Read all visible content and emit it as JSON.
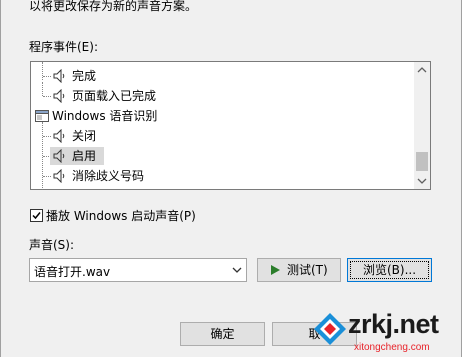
{
  "intro_text": "以将更改保存为新的声音方案。",
  "events_label": "程序事件(E):",
  "tree_items": [
    {
      "label": "完成",
      "icon": "speaker-icon"
    },
    {
      "label": "页面载入已完成",
      "icon": "speaker-icon"
    },
    {
      "label": "Windows 语音识别",
      "icon": "app-icon"
    },
    {
      "label": "关闭",
      "icon": "speaker-icon"
    },
    {
      "label": "启用",
      "icon": "speaker-icon"
    },
    {
      "label": "消除歧义号码",
      "icon": "speaker-icon"
    }
  ],
  "startup_checkbox": {
    "label": "播放 Windows 启动声音(P)",
    "checked": true
  },
  "sound_label": "声音(S):",
  "sound_select": {
    "value": "语音打开.wav"
  },
  "test_button": "测试(T)",
  "browse_button": "浏览(B)...",
  "ok_button": "确定",
  "cancel_button": "取",
  "watermark": {
    "brand": "zrkj.net",
    "sub": "xitongcheng.com"
  }
}
